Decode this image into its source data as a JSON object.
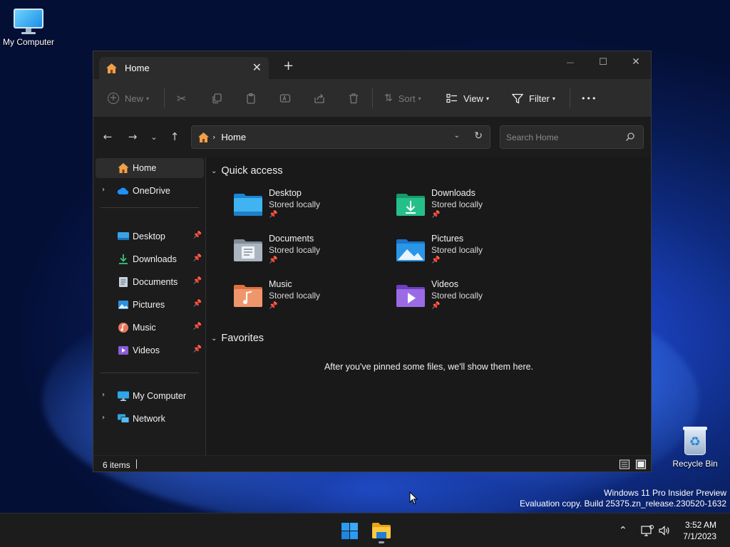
{
  "desktop": {
    "icons": [
      {
        "label": "My Computer"
      },
      {
        "label": "Recycle Bin"
      }
    ],
    "watermark": {
      "line1": "Windows 11 Pro Insider Preview",
      "line2": "Evaluation copy. Build 25375.zn_release.230520-1632"
    }
  },
  "window": {
    "tab": {
      "title": "Home",
      "close": "✕"
    },
    "new_tab": "+",
    "caption": {
      "minimize": "—",
      "maximize": "☐",
      "close": "✕"
    },
    "toolbar": {
      "new_label": "New",
      "sort_label": "Sort",
      "view_label": "View",
      "filter_label": "Filter",
      "more_label": "•••"
    },
    "address": {
      "crumb": "Home",
      "search_placeholder": "Search Home"
    },
    "sidebar": {
      "home": "Home",
      "onedrive": "OneDrive",
      "pinned": [
        {
          "label": "Desktop"
        },
        {
          "label": "Downloads"
        },
        {
          "label": "Documents"
        },
        {
          "label": "Pictures"
        },
        {
          "label": "Music"
        },
        {
          "label": "Videos"
        }
      ],
      "my_computer": "My Computer",
      "network": "Network"
    },
    "content": {
      "quick_access_title": "Quick access",
      "tiles": [
        {
          "name": "Desktop",
          "status": "Stored locally"
        },
        {
          "name": "Downloads",
          "status": "Stored locally"
        },
        {
          "name": "Documents",
          "status": "Stored locally"
        },
        {
          "name": "Pictures",
          "status": "Stored locally"
        },
        {
          "name": "Music",
          "status": "Stored locally"
        },
        {
          "name": "Videos",
          "status": "Stored locally"
        }
      ],
      "favorites_title": "Favorites",
      "favorites_empty": "After you've pinned some files, we'll show them here."
    },
    "status": {
      "item_count": "6 items"
    }
  },
  "taskbar": {
    "clock_time": "3:52 AM",
    "clock_date": "7/1/2023"
  },
  "colors": {
    "accent": "#0078d4",
    "window_bg": "#1c1c1c",
    "toolbar_bg": "#2c2c2c",
    "home_icon": "#f0a04a"
  }
}
